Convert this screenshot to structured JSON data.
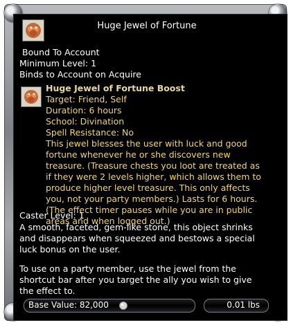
{
  "tooltip": {
    "title": "Huge Jewel of Fortune",
    "bound": "Bound To Account",
    "min_level": "Minimum Level: 1",
    "binds": "Binds to Account on Acquire",
    "buff": {
      "name": "Huge Jewel of Fortune Boost",
      "target": "Target: Friend, Self",
      "duration": "Duration: 6 hours",
      "school": "School: Divination",
      "spell_resistance": "Spell Resistance: No",
      "description_lines": [
        "This jewel blesses the user with luck and good",
        "fortune whenever he or she discovers new",
        "treasure. (Treasure chests you loot are treated as",
        "if they were 2 levels higher, which allows them to",
        "produce higher level treasure. This only affects",
        "you, not your party members.) Lasts for 6 hours.",
        "(The effect timer pauses while you are in public",
        "areas and when logged out.)"
      ]
    },
    "caster_level": "Caster Level: 1",
    "item_description_lines": [
      "A smooth, faceted, gem-like stone, this object shrinks",
      "and disappears when squeezed and bestows a special",
      "luck bonus on the user.",
      "",
      "To use on a party member, use the jewel from the",
      "shortcut bar after you target the ally you wish to give",
      "the effect to."
    ],
    "base_value": "Base Value: 82,000",
    "weight": "0.01 lbs"
  },
  "icons": {
    "item_icon": "jewel-of-fortune-icon",
    "buff_icon": "fortune-boost-icon",
    "coin_icon": "coin-icon"
  }
}
